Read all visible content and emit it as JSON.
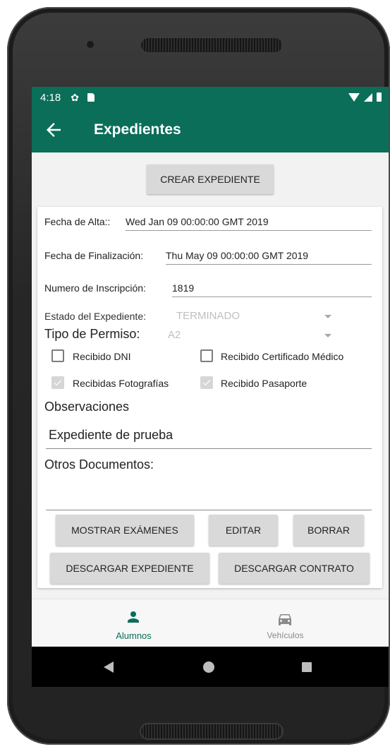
{
  "status_bar": {
    "time": "4:18"
  },
  "app_bar": {
    "title": "Expedientes"
  },
  "create_button": "CREAR EXPEDIENTE",
  "form": {
    "fecha_alta": {
      "label": "Fecha de Alta::",
      "value": "Wed Jan 09 00:00:00 GMT 2019"
    },
    "fecha_finalizacion": {
      "label": "Fecha de Finalización:",
      "value": "Thu May 09 00:00:00 GMT 2019"
    },
    "numero_inscripcion": {
      "label": "Numero de Inscripción:",
      "value": "1819"
    },
    "estado_expediente": {
      "label": "Estado del Expediente:",
      "value": "TERMINADO"
    },
    "tipo_permiso": {
      "label": "Tipo de Permiso:",
      "value": "A2"
    },
    "checkboxes": [
      {
        "label": "Recibido DNI",
        "checked": false
      },
      {
        "label": "Recibido Certificado Médico",
        "checked": false
      },
      {
        "label": "Recibidas Fotografías",
        "checked": true
      },
      {
        "label": "Recibido Pasaporte",
        "checked": true
      }
    ],
    "observaciones": {
      "label": "Observaciones",
      "value": "Expediente de prueba"
    },
    "otros_documentos": {
      "label": "Otros Documentos:",
      "value": ""
    }
  },
  "actions": {
    "mostrar_examenes": "MOSTRAR EXÁMENES",
    "editar": "EDITAR",
    "borrar": "BORRAR",
    "descargar_expediente": "DESCARGAR EXPEDIENTE",
    "descargar_contrato": "DESCARGAR CONTRATO"
  },
  "bottom_nav": [
    {
      "label": "Alumnos",
      "icon": "person-icon",
      "active": true
    },
    {
      "label": "Vehículos",
      "icon": "car-icon",
      "active": false
    }
  ],
  "colors": {
    "primary": "#0a6e58",
    "button": "#d9d9d9",
    "inactive": "#8a8a8a"
  }
}
